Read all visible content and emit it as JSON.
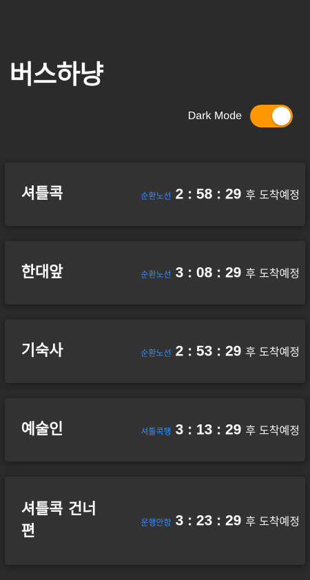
{
  "app": {
    "title": "버스하냥"
  },
  "theme": {
    "label": "Dark Mode",
    "enabled": true,
    "accent_color": "#ff9800",
    "background_color": "#2b2b2b",
    "route_color": "#3a8ef0"
  },
  "stops": [
    {
      "name": "셔틀콕",
      "route": "순환노선",
      "time": "2 : 58 : 29",
      "suffix": "후 도착예정"
    },
    {
      "name": "한대앞",
      "route": "순환노선",
      "time": "3 : 08 : 29",
      "suffix": "후 도착예정"
    },
    {
      "name": "기숙사",
      "route": "순환노선",
      "time": "2 : 53 : 29",
      "suffix": "후 도착예정"
    },
    {
      "name": "예술인",
      "route": "셔틀콕행",
      "time": "3 : 13 : 29",
      "suffix": "후 도착예정"
    },
    {
      "name": "셔틀콕 건너편",
      "route": "운행안함",
      "time": "3 : 23 : 29",
      "suffix": "후 도착예정"
    }
  ]
}
